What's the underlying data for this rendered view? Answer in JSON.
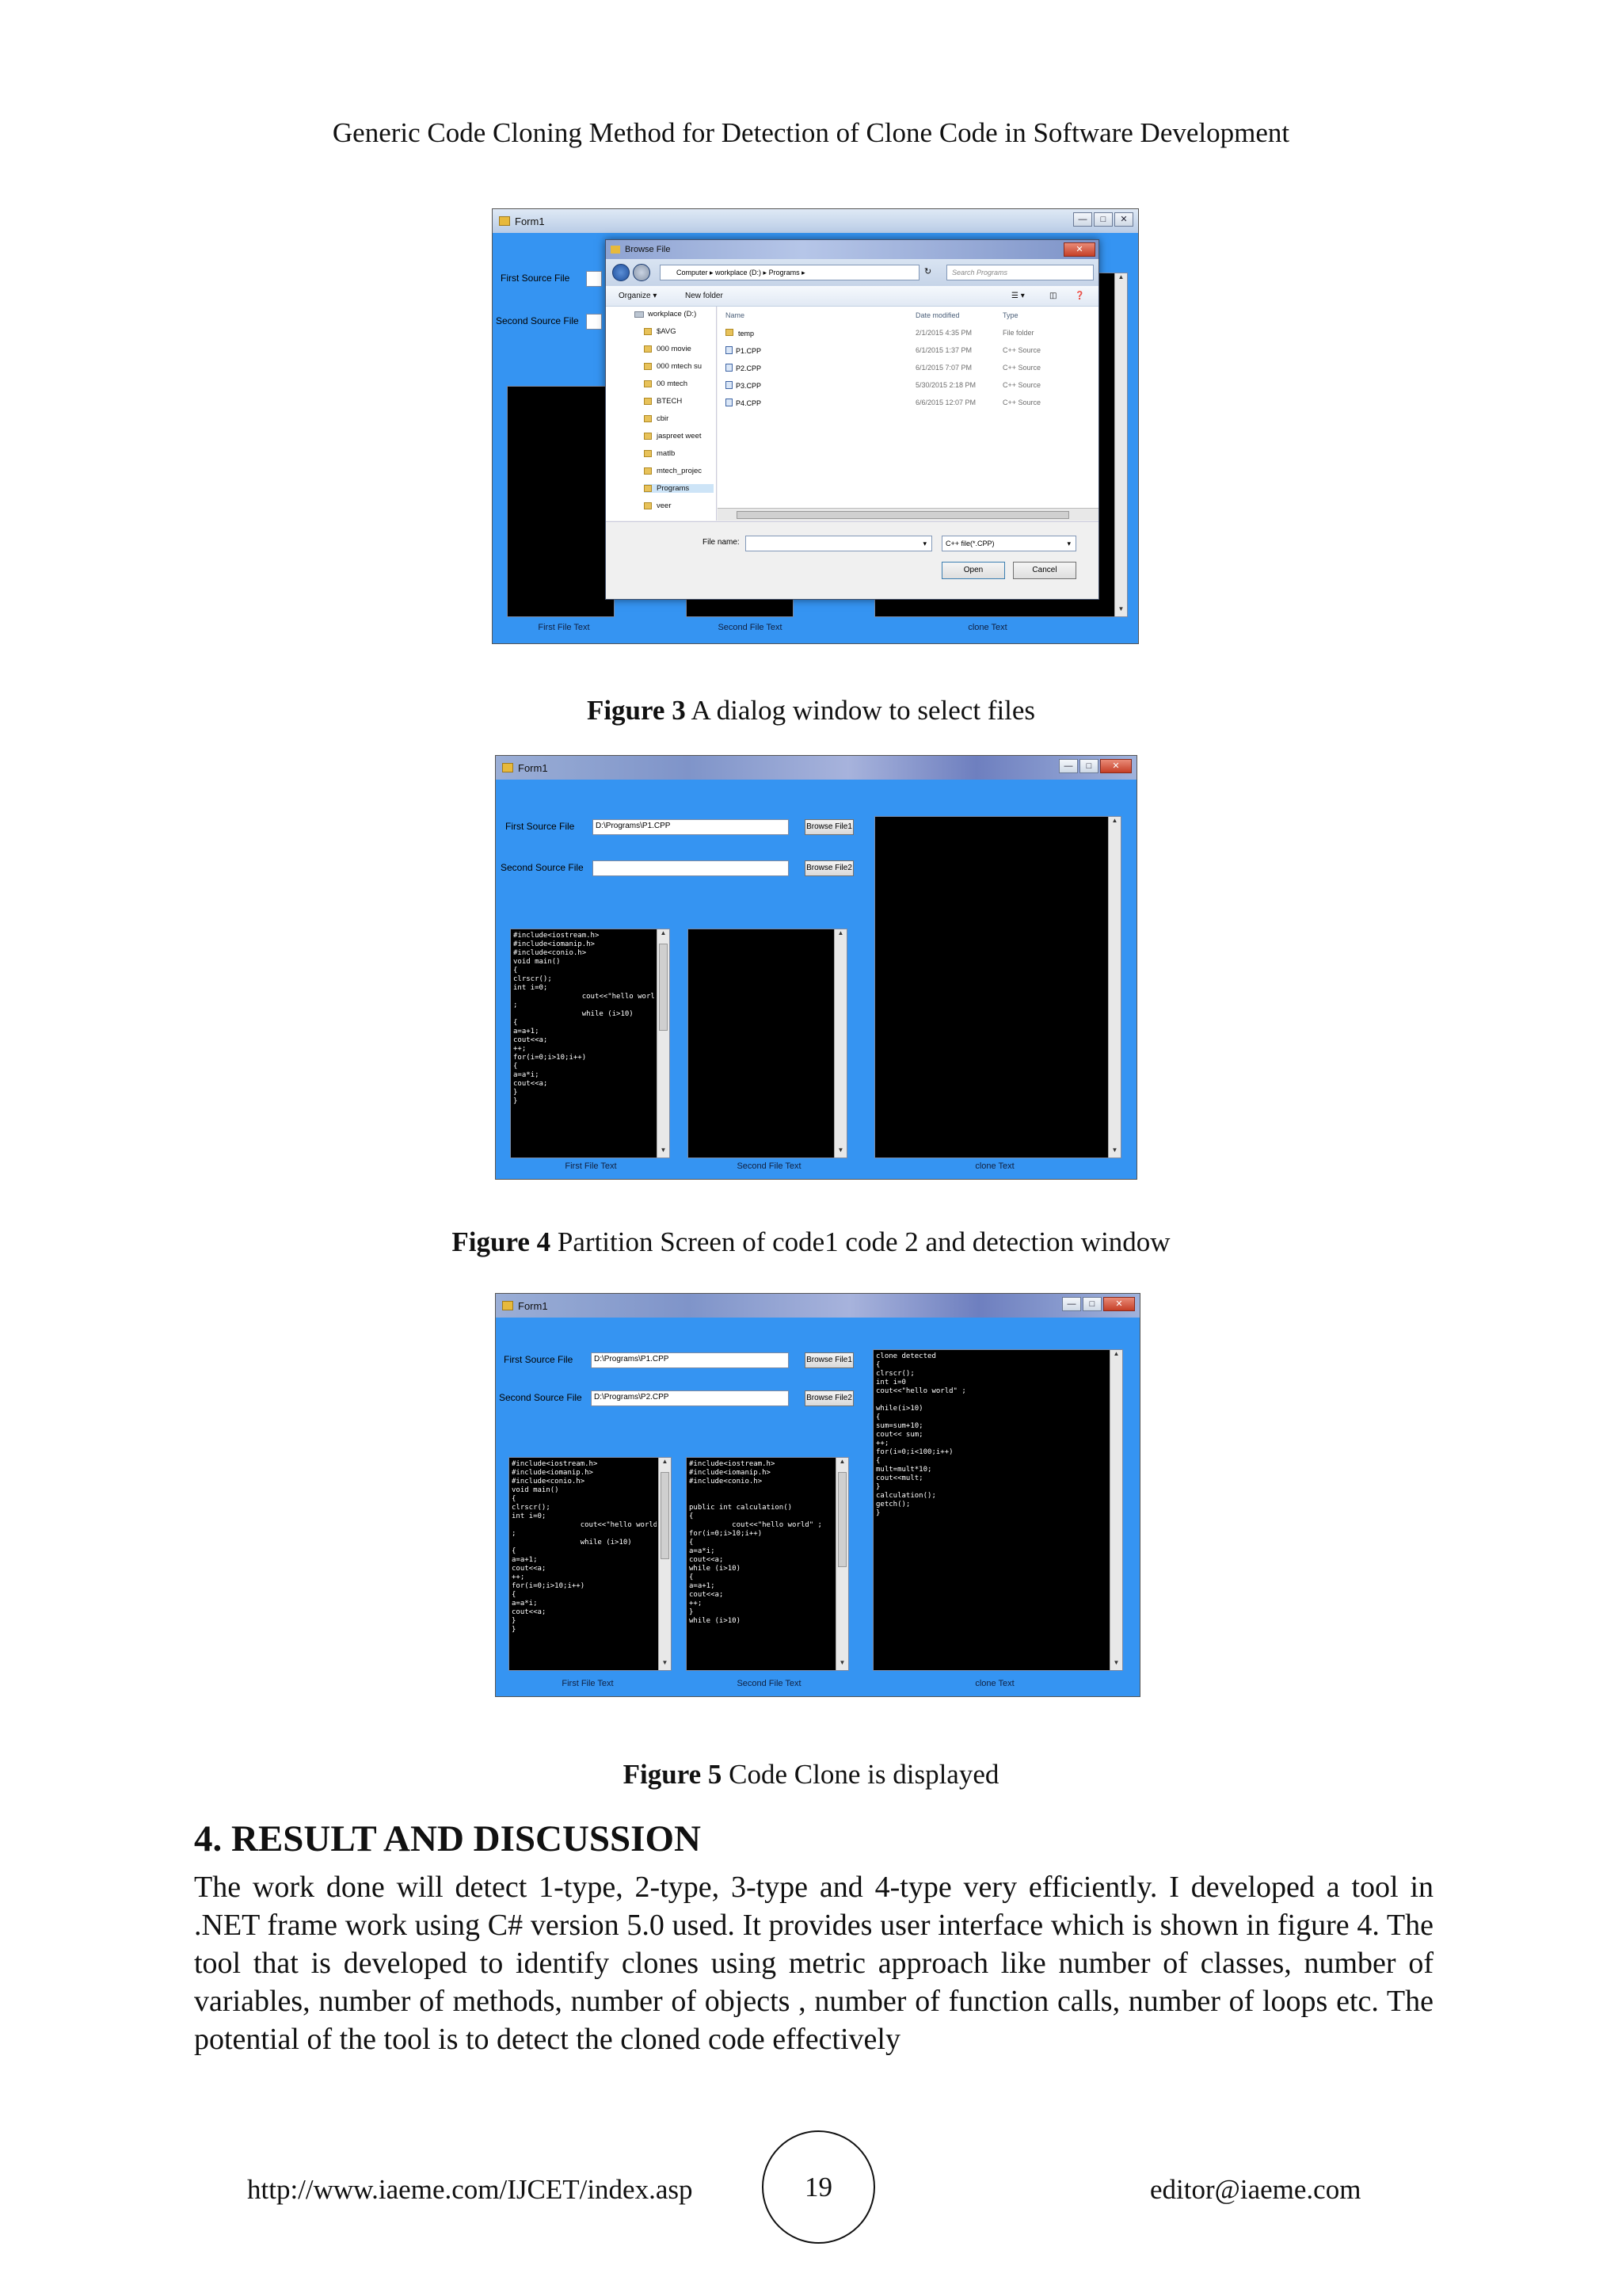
{
  "running_header": "Generic Code Cloning Method for Detection of Clone Code in Software Development",
  "figure3": {
    "caption_label": "Figure 3",
    "caption_text": " A dialog window to select files",
    "form": {
      "title": "Form1",
      "first_source_label": "First Source File",
      "second_source_label": "Second Source File",
      "pane_labels": [
        "First File Text",
        "Second File Text",
        "clone Text"
      ]
    },
    "dialog": {
      "title": "Browse File",
      "address": "Computer  ▸  workplace (D:)  ▸  Programs  ▸",
      "search_placeholder": "Search Programs",
      "organize": "Organize ▾",
      "new_folder": "New folder",
      "tree": [
        {
          "label": "workplace (D:)",
          "kind": "drive"
        },
        {
          "label": "$AVG",
          "kind": "folder"
        },
        {
          "label": "000 movie",
          "kind": "folder"
        },
        {
          "label": "000 mtech su",
          "kind": "folder"
        },
        {
          "label": "00 mtech",
          "kind": "folder"
        },
        {
          "label": "BTECH",
          "kind": "folder"
        },
        {
          "label": "cbir",
          "kind": "folder"
        },
        {
          "label": "jaspreet weet",
          "kind": "folder"
        },
        {
          "label": "matlb",
          "kind": "folder"
        },
        {
          "label": "mtech_projec",
          "kind": "folder"
        },
        {
          "label": "Programs",
          "kind": "folder"
        },
        {
          "label": "veer",
          "kind": "folder"
        }
      ],
      "columns": {
        "name": "Name",
        "date": "Date modified",
        "type": "Type"
      },
      "files": [
        {
          "name": "temp",
          "date": "2/1/2015 4:35 PM",
          "type": "File folder",
          "kind": "folder"
        },
        {
          "name": "P1.CPP",
          "date": "6/1/2015 1:37 PM",
          "type": "C++ Source",
          "kind": "cpp"
        },
        {
          "name": "P2.CPP",
          "date": "6/1/2015 7:07 PM",
          "type": "C++ Source",
          "kind": "cpp"
        },
        {
          "name": "P3.CPP",
          "date": "5/30/2015 2:18 PM",
          "type": "C++ Source",
          "kind": "cpp"
        },
        {
          "name": "P4.CPP",
          "date": "6/6/2015 12:07 PM",
          "type": "C++ Source",
          "kind": "cpp"
        }
      ],
      "file_name_label": "File name:",
      "file_filter": "C++ file(*.CPP)",
      "open_button": "Open",
      "cancel_button": "Cancel"
    }
  },
  "figure4": {
    "caption_label": "Figure 4",
    "caption_text": " Partition Screen of code1 code 2 and detection window",
    "form": {
      "title": "Form1",
      "first_source_label": "First Source File",
      "second_source_label": "Second Source File",
      "first_source_value": "D:\\Programs\\P1.CPP",
      "second_source_value": "",
      "browse1": "Browse File1",
      "browse2": "Browse File2",
      "first_code": "#include<iostream.h>\n#include<iomanip.h>\n#include<conio.h>\nvoid main()\n{\nclrscr();\nint i=0;\n                cout<<\"hello world\"\n;\n                while (i>10)\n{\na=a+1;\ncout<<a;\n++;\nfor(i=0;i>10;i++)\n{\na=a*i;\ncout<<a;\n}\n}",
      "second_code": "",
      "clone_code": "",
      "pane_labels": [
        "First File Text",
        "Second File Text",
        "clone Text"
      ]
    }
  },
  "figure5": {
    "caption_label": "Figure 5",
    "caption_text": " Code Clone is displayed",
    "form": {
      "title": "Form1",
      "first_source_label": "First Source File",
      "second_source_label": "Second Source File",
      "first_source_value": "D:\\Programs\\P1.CPP",
      "second_source_value": "D:\\Programs\\P2.CPP",
      "browse1": "Browse File1",
      "browse2": "Browse File2",
      "first_code": "#include<iostream.h>\n#include<iomanip.h>\n#include<conio.h>\nvoid main()\n{\nclrscr();\nint i=0;\n                cout<<\"hello world\"\n;\n                while (i>10)\n{\na=a+1;\ncout<<a;\n++;\nfor(i=0;i>10;i++)\n{\na=a*i;\ncout<<a;\n}\n}",
      "second_code": "#include<iostream.h>\n#include<iomanip.h>\n#include<conio.h>\n\n\npublic int calculation()\n{\n          cout<<\"hello world\" ;\nfor(i=0;i>10;i++)\n{\na=a*i;\ncout<<a;\nwhile (i>10)\n{\na=a+1;\ncout<<a;\n++;\n}\nwhile (i>10)",
      "clone_code": "clone detected\n{\nclrscr();\nint i=0\ncout<<\"hello world\" ;\n\nwhile(i>10)\n{\nsum=sum+10;\ncout<< sum;\n++;\nfor(i=0;i<100;i++)\n{\nmult=mult*10;\ncout<<mult;\n}\ncalculation();\ngetch();\n}",
      "pane_labels": [
        "First File Text",
        "Second File Text",
        "clone Text"
      ]
    }
  },
  "section": {
    "title": "4. RESULT AND DISCUSSION",
    "body": "The work done will detect 1-type, 2-type, 3-type and 4-type very efficiently. I developed a tool in .NET frame work using C# version 5.0 used.  It provides user interface which is shown in figure 4. The tool that is developed to identify clones using metric approach like number of classes, number of variables, number of methods, number of objects , number of function calls, number of loops etc. The potential of the tool is to detect the cloned code effectively"
  },
  "footer": {
    "url": "http://www.iaeme.com/IJCET/index.asp",
    "page_number": "19",
    "email": "editor@iaeme.com"
  }
}
